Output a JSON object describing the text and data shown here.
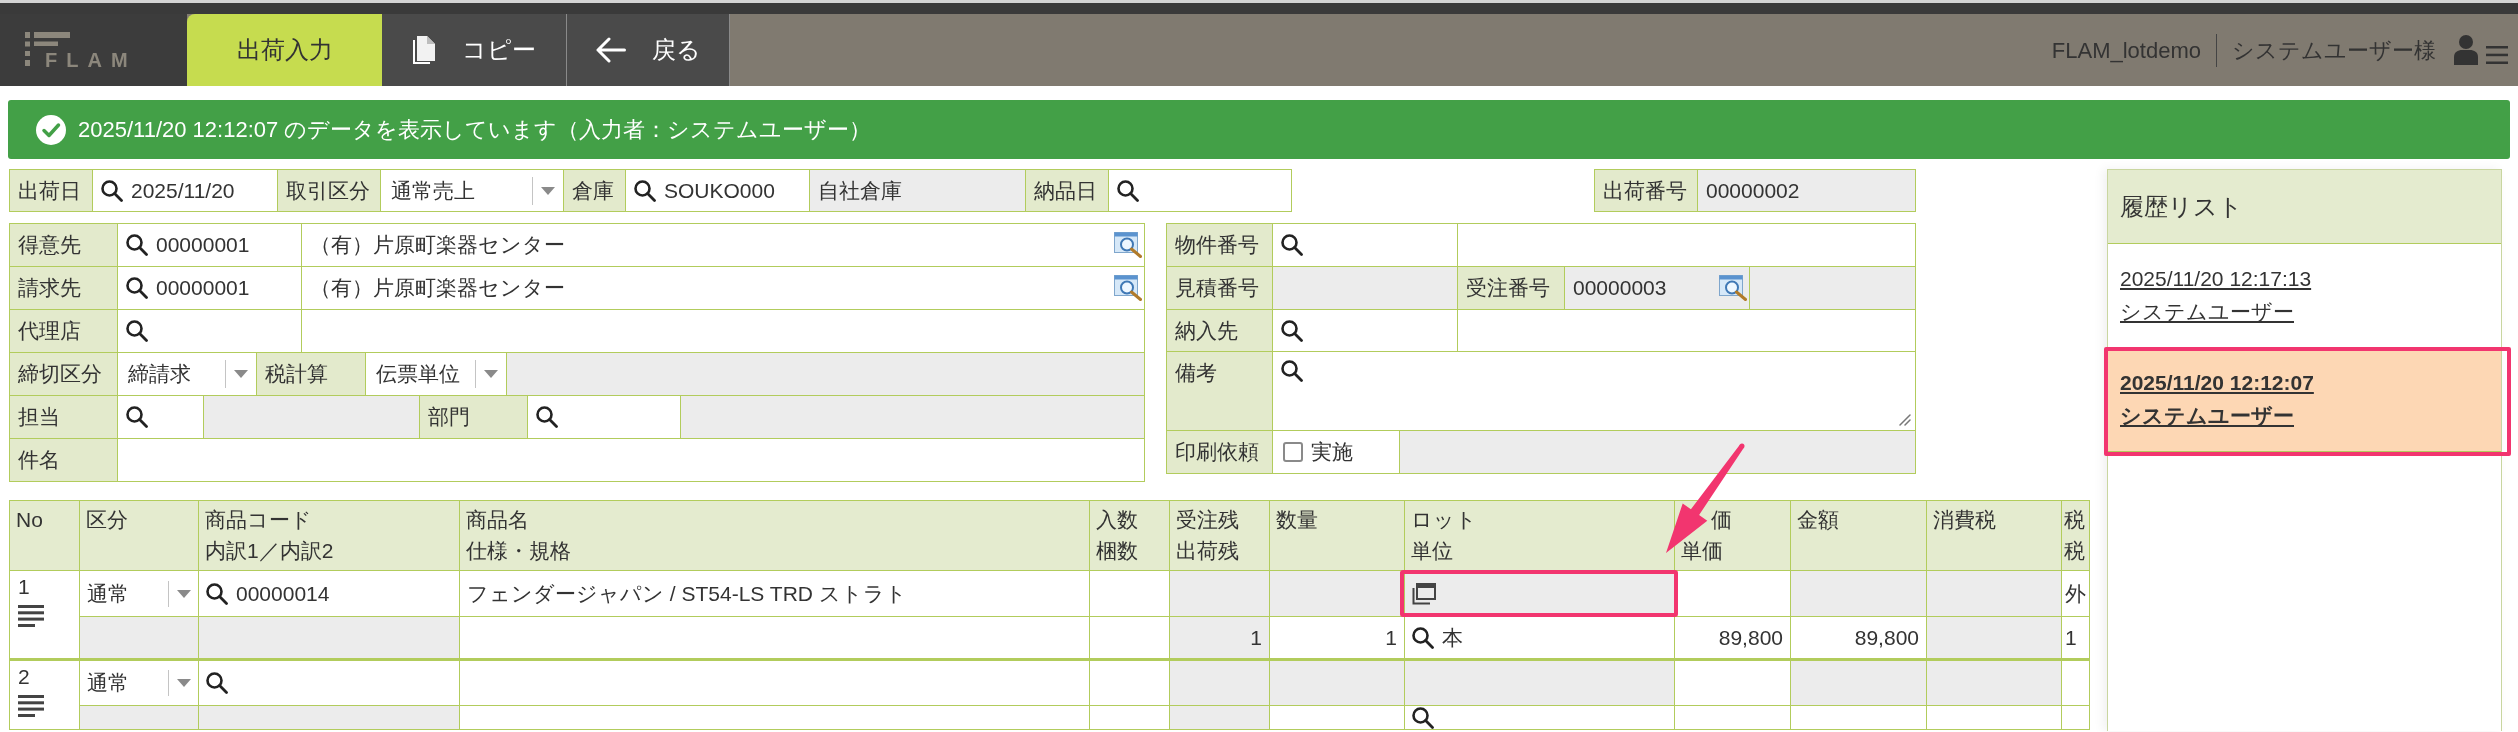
{
  "header": {
    "logo": "FLAM",
    "tabs": [
      {
        "label": "出荷入力",
        "kind": "page",
        "selected": true
      },
      {
        "label": "コピー",
        "kind": "copy",
        "selected": false
      },
      {
        "label": "戻る",
        "kind": "back",
        "selected": false
      }
    ],
    "company": "FLAM_lotdemo",
    "user": "システムユーザー様"
  },
  "banner": {
    "message": "2025/11/20 12:12:07 のデータを表示しています（入力者：システムユーザー）"
  },
  "header_fields": [
    {
      "kind": "label",
      "value": "出荷日"
    },
    {
      "kind": "search",
      "value": "2025/11/20"
    },
    {
      "kind": "label",
      "value": "取引区分"
    },
    {
      "kind": "select",
      "value": "通常売上"
    },
    {
      "kind": "label",
      "value": "倉庫"
    },
    {
      "kind": "search",
      "value": "SOUKO000"
    },
    {
      "kind": "readonly",
      "value": "自社倉庫"
    },
    {
      "kind": "label",
      "value": "納品日"
    },
    {
      "kind": "search"
    }
  ],
  "shipment_number": [
    {
      "kind": "label",
      "value": "出荷番号"
    },
    {
      "kind": "readonly",
      "value": "00000002"
    }
  ],
  "customer_form": [
    {
      "label": "得意先",
      "cells": [
        {
          "kind": "search",
          "value": "00000001"
        },
        {
          "kind": "text",
          "value": "（有）片原町楽器センター",
          "lookup": true
        }
      ]
    },
    {
      "label": "請求先",
      "cells": [
        {
          "kind": "search",
          "value": "00000001"
        },
        {
          "kind": "text",
          "value": "（有）片原町楽器センター",
          "lookup": true
        }
      ]
    },
    {
      "label": "代理店",
      "cells": [
        {
          "kind": "search"
        },
        {
          "kind": "text"
        }
      ]
    },
    {
      "label": "締切区分",
      "cells": [
        {
          "kind": "select",
          "value": "締請求"
        },
        {
          "kind": "label",
          "value": "税計算"
        },
        {
          "kind": "select",
          "value": "伝票単位"
        },
        {
          "kind": "readonly"
        }
      ]
    },
    {
      "label": "担当",
      "cells": [
        {
          "kind": "search"
        },
        {
          "kind": "readonly"
        },
        {
          "kind": "label",
          "value": "部門"
        },
        {
          "kind": "search"
        },
        {
          "kind": "readonly"
        }
      ]
    },
    {
      "label": "件名",
      "cells": [
        {
          "kind": "text"
        }
      ]
    }
  ],
  "order_form": [
    {
      "label": "物件番号",
      "cells": [
        {
          "kind": "search"
        },
        {
          "kind": "text"
        }
      ]
    },
    {
      "label": "見積番号",
      "cells": [
        {
          "kind": "readonly"
        },
        {
          "kind": "label",
          "value": "受注番号"
        },
        {
          "kind": "readonly",
          "value": "00000003",
          "lookup": true
        },
        {
          "kind": "readonly"
        }
      ]
    },
    {
      "label": "納入先",
      "cells": [
        {
          "kind": "search"
        },
        {
          "kind": "text"
        }
      ]
    },
    {
      "label": "備考",
      "cells": [
        {
          "kind": "textarea"
        }
      ]
    },
    {
      "label": "印刷依頼",
      "cells": [
        {
          "kind": "checkbox",
          "value": "実施",
          "checked": false
        },
        {
          "kind": "readonly"
        }
      ]
    }
  ],
  "table": {
    "columns": [
      {
        "lines": [
          "No"
        ]
      },
      {
        "lines": [
          "区分"
        ]
      },
      {
        "lines": [
          "商品コード",
          "内訳1／内訳2"
        ]
      },
      {
        "lines": [
          "商品名",
          "仕様・規格"
        ]
      },
      {
        "lines": [
          "入数",
          "梱数"
        ]
      },
      {
        "lines": [
          "受注残",
          "出荷残"
        ]
      },
      {
        "lines": [
          "数量"
        ]
      },
      {
        "lines": [
          "ロット",
          "単位"
        ]
      },
      {
        "lines": [
          "価",
          "単価"
        ]
      },
      {
        "lines": [
          "金額"
        ]
      },
      {
        "lines": [
          "消費税"
        ]
      },
      {
        "lines": [
          "税",
          "税"
        ]
      }
    ],
    "rows": [
      {
        "no": "1",
        "top": [
          {
            "kind": "select",
            "value": "通常"
          },
          {
            "kind": "search",
            "value": "00000014"
          },
          {
            "kind": "input",
            "value": "フェンダージャパン / ST54-LS TRD ストラト"
          },
          {
            "kind": "input"
          },
          {
            "kind": "readonly"
          },
          {
            "kind": "readonly"
          },
          {
            "kind": "lot"
          },
          {
            "kind": "input"
          },
          {
            "kind": "readonly"
          },
          {
            "kind": "readonly"
          },
          {
            "kind": "input",
            "value": "外"
          }
        ],
        "bottom": [
          {
            "kind": "readonly"
          },
          {
            "kind": "readonly"
          },
          {
            "kind": "input"
          },
          {
            "kind": "input"
          },
          {
            "kind": "readonly",
            "value": "1"
          },
          {
            "kind": "input",
            "value": "1"
          },
          {
            "kind": "search",
            "value": "本"
          },
          {
            "kind": "input",
            "value": "89,800"
          },
          {
            "kind": "input",
            "value": "89,800"
          },
          {
            "kind": "readonly"
          },
          {
            "kind": "input",
            "value": "1"
          }
        ]
      },
      {
        "no": "2",
        "top": [
          {
            "kind": "select",
            "value": "通常"
          },
          {
            "kind": "search"
          },
          {
            "kind": "input"
          },
          {
            "kind": "input"
          },
          {
            "kind": "readonly"
          },
          {
            "kind": "readonly"
          },
          {
            "kind": "readonly"
          },
          {
            "kind": "input"
          },
          {
            "kind": "readonly"
          },
          {
            "kind": "readonly"
          },
          {
            "kind": "input"
          }
        ],
        "bottom": [
          {
            "kind": "readonly"
          },
          {
            "kind": "readonly"
          },
          {
            "kind": "input"
          },
          {
            "kind": "input"
          },
          {
            "kind": "readonly"
          },
          {
            "kind": "input"
          },
          {
            "kind": "search"
          },
          {
            "kind": "input"
          },
          {
            "kind": "input"
          },
          {
            "kind": "input"
          },
          {
            "kind": "input"
          }
        ]
      }
    ]
  },
  "history": {
    "title": "履歴リスト",
    "entries": [
      {
        "timestamp": "2025/11/20 12:17:13",
        "user": "システムユーザー",
        "selected": false
      },
      {
        "timestamp": "2025/11/20 12:12:07",
        "user": "システムユーザー",
        "selected": true
      }
    ]
  }
}
